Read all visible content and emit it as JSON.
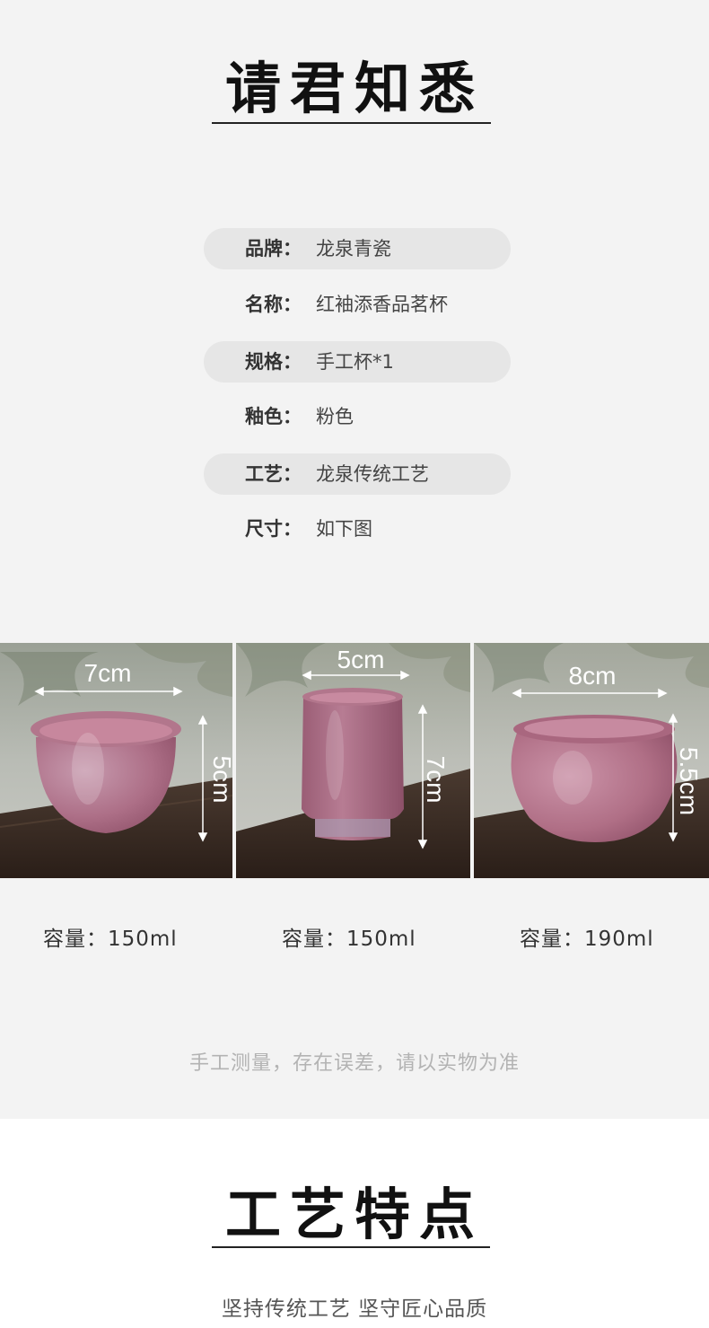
{
  "notice": {
    "title": "请君知悉"
  },
  "specs": [
    {
      "label": "品牌：",
      "value": "龙泉青瓷",
      "shaded": true
    },
    {
      "label": "名称：",
      "value": "红袖添香品茗杯",
      "shaded": false
    },
    {
      "label": "规格：",
      "value": "手工杯*1",
      "shaded": true
    },
    {
      "label": "釉色：",
      "value": "粉色",
      "shaded": false
    },
    {
      "label": "工艺：",
      "value": "龙泉传统工艺",
      "shaded": true
    },
    {
      "label": "尺寸：",
      "value": "如下图",
      "shaded": false
    }
  ],
  "cups": [
    {
      "width_label": "7cm",
      "height_label": "5cm",
      "capacity": "容量：150ml"
    },
    {
      "width_label": "5cm",
      "height_label": "7cm",
      "capacity": "容量：150ml"
    },
    {
      "width_label": "8cm",
      "height_label": "5.5cm",
      "capacity": "容量：190ml"
    }
  ],
  "note": "手工测量，存在误差，请以实物为准",
  "craft": {
    "title": "工艺特点",
    "subtitle": "坚持传统工艺 坚守匠心品质"
  },
  "colors": {
    "glaze": "#b06f86",
    "wood": "#3a2a22",
    "background": "#f3f3f3"
  }
}
